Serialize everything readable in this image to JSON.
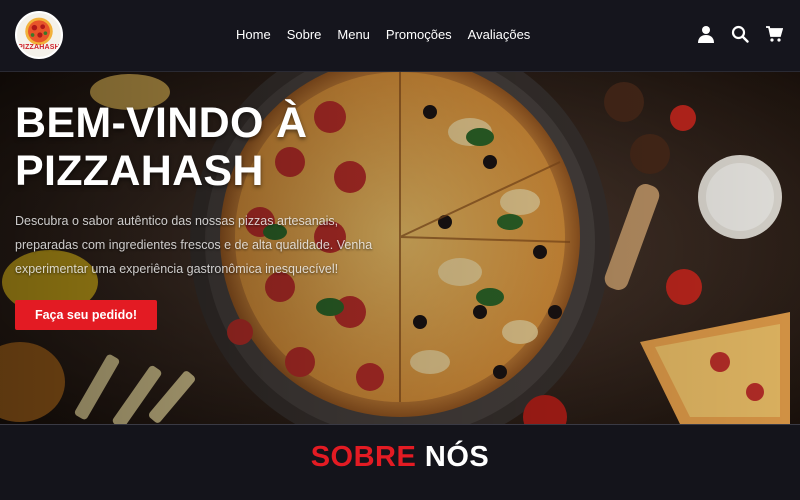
{
  "brand": {
    "logo_text": "PIZZAHASH",
    "accent_color": "#e31b23"
  },
  "nav": {
    "items": [
      {
        "label": "Home"
      },
      {
        "label": "Sobre"
      },
      {
        "label": "Menu"
      },
      {
        "label": "Promoções"
      },
      {
        "label": "Avaliações"
      }
    ]
  },
  "header_icons": [
    "user-icon",
    "search-icon",
    "cart-icon"
  ],
  "hero": {
    "title": "BEM-VINDO À PIZZAHASH",
    "description": "Descubra o sabor autêntico das nossas pizzas artesanais, preparadas com ingredientes frescos e de alta qualidade. Venha experimentar uma experiência gastronômica inesquecível!",
    "cta_label": "Faça seu pedido!"
  },
  "about": {
    "title_red": "SOBRE",
    "title_white": "NÓS"
  }
}
